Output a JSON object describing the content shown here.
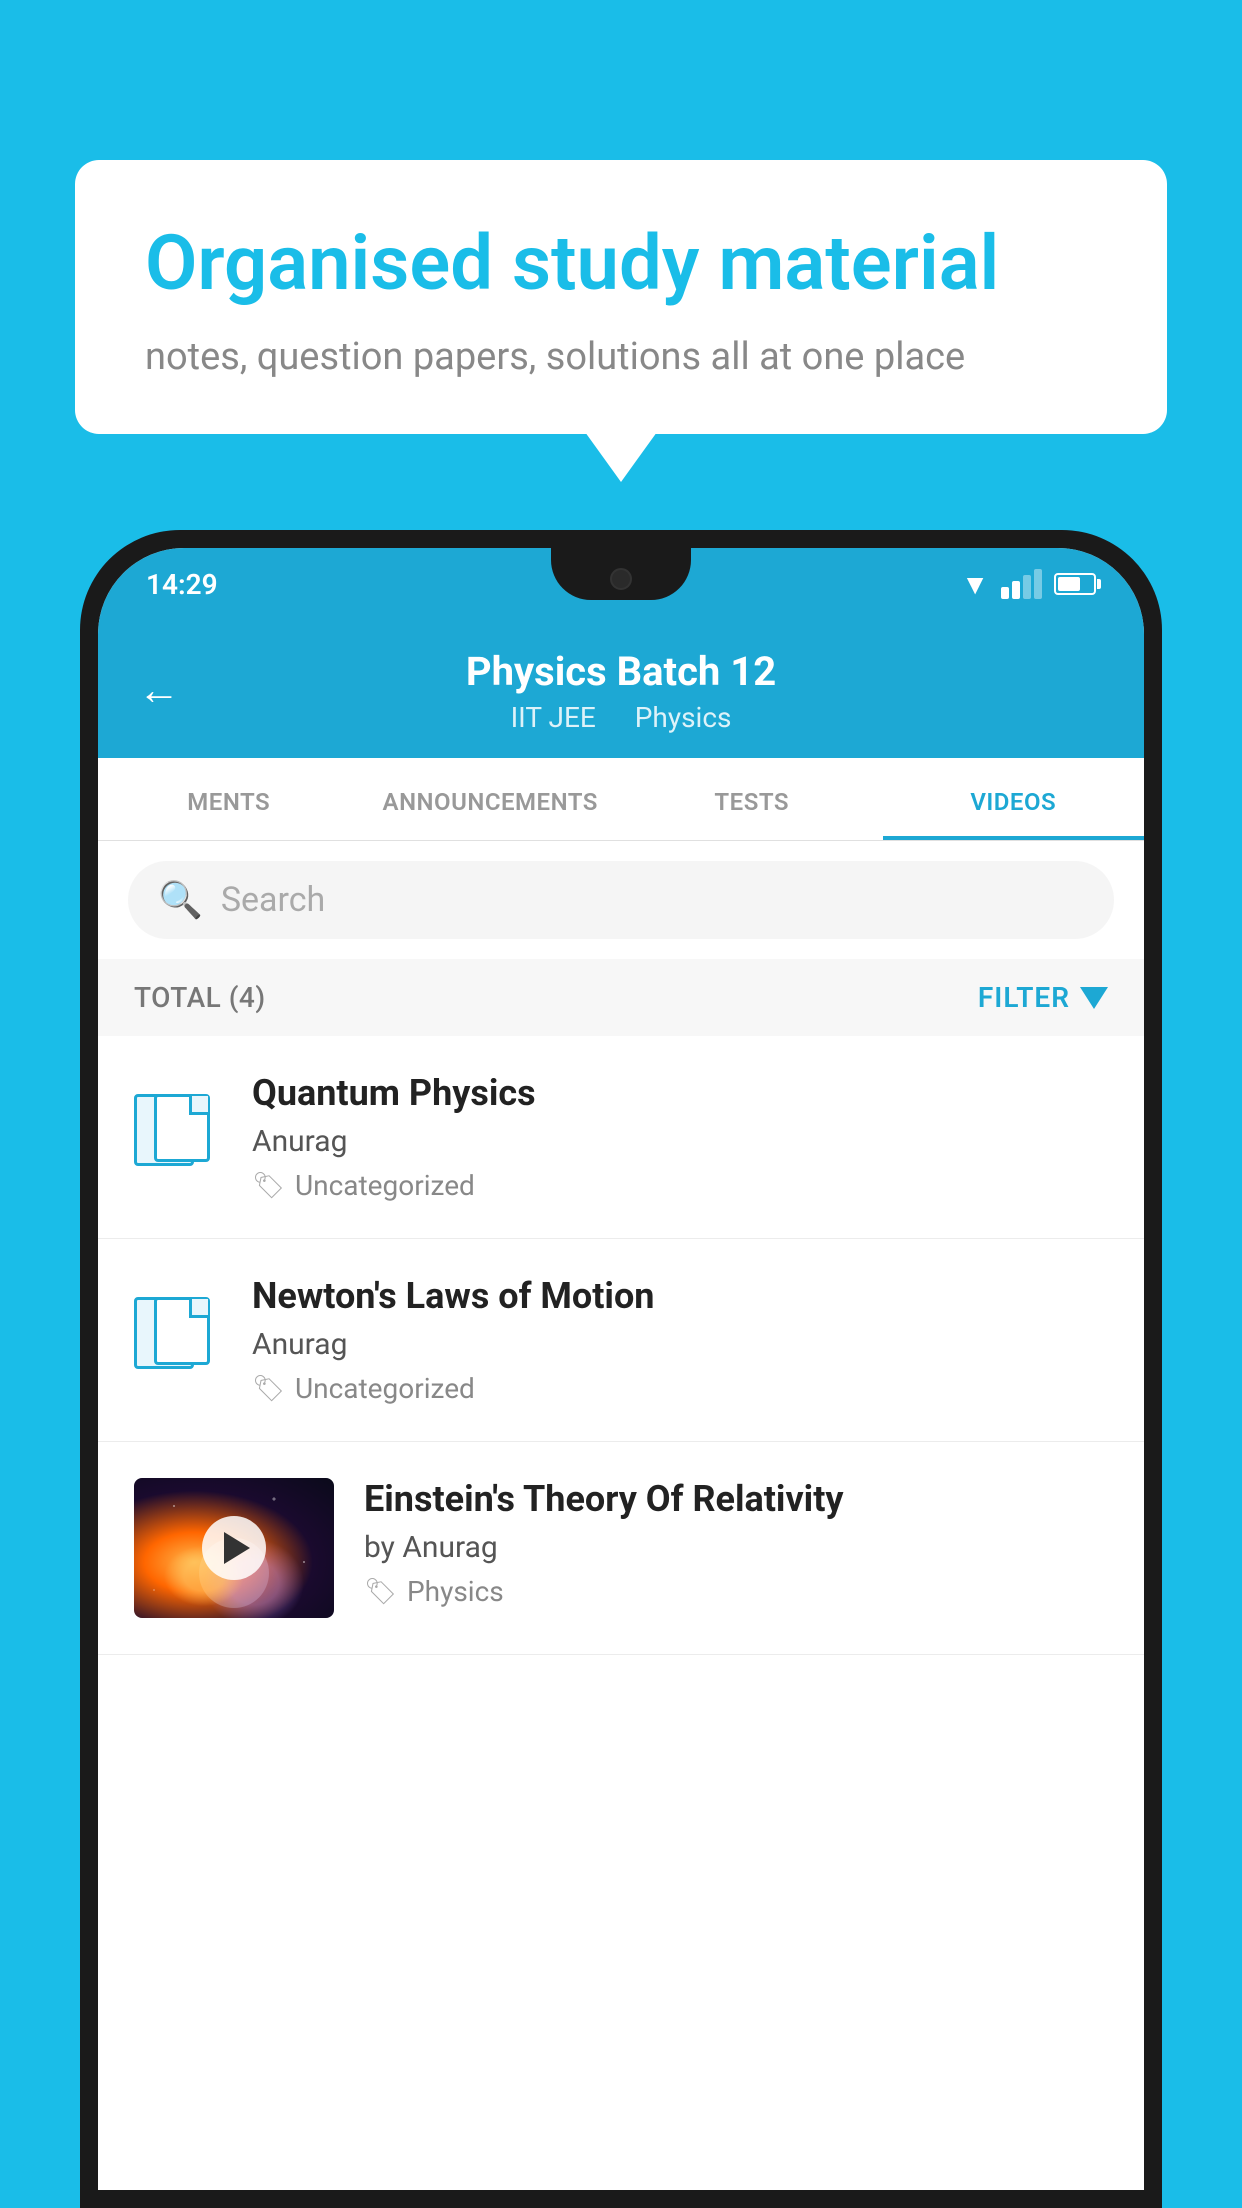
{
  "background_color": "#1ABDE8",
  "bubble": {
    "title": "Organised study material",
    "subtitle": "notes, question papers, solutions all at one place"
  },
  "status_bar": {
    "time": "14:29"
  },
  "header": {
    "title": "Physics Batch 12",
    "subtitle_part1": "IIT JEE",
    "subtitle_part2": "Physics",
    "back_label": "←"
  },
  "tabs": [
    {
      "label": "MENTS",
      "active": false
    },
    {
      "label": "ANNOUNCEMENTS",
      "active": false
    },
    {
      "label": "TESTS",
      "active": false
    },
    {
      "label": "VIDEOS",
      "active": true
    }
  ],
  "search": {
    "placeholder": "Search"
  },
  "filter_bar": {
    "total_label": "TOTAL (4)",
    "filter_label": "FILTER"
  },
  "videos": [
    {
      "id": 1,
      "title": "Quantum Physics",
      "author": "Anurag",
      "tag": "Uncategorized",
      "has_thumb": false
    },
    {
      "id": 2,
      "title": "Newton's Laws of Motion",
      "author": "Anurag",
      "tag": "Uncategorized",
      "has_thumb": false
    },
    {
      "id": 3,
      "title": "Einstein's Theory Of Relativity",
      "author": "by Anurag",
      "tag": "Physics",
      "has_thumb": true
    }
  ]
}
